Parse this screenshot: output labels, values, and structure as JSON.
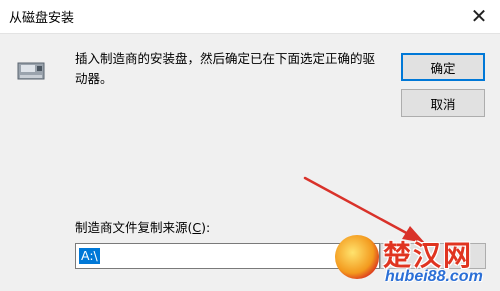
{
  "window": {
    "title": "从磁盘安装",
    "close_glyph": "✕"
  },
  "message": "插入制造商的安装盘，然后确定已在下面选定正确的驱动器。",
  "buttons": {
    "ok_label": "确定",
    "cancel_label": "取消"
  },
  "source": {
    "label_prefix": "制造商文件复制来源(",
    "label_accel": "C",
    "label_suffix": "):",
    "value": "A:\\"
  },
  "watermark": {
    "title": "楚汉网",
    "domain": "hubei88.com"
  },
  "icons": {
    "disk": "floppy-disk-icon",
    "close": "close-icon"
  },
  "colors": {
    "accent": "#0078d7",
    "arrow": "#d9322a",
    "dialog_bg": "#f0f0f0"
  }
}
